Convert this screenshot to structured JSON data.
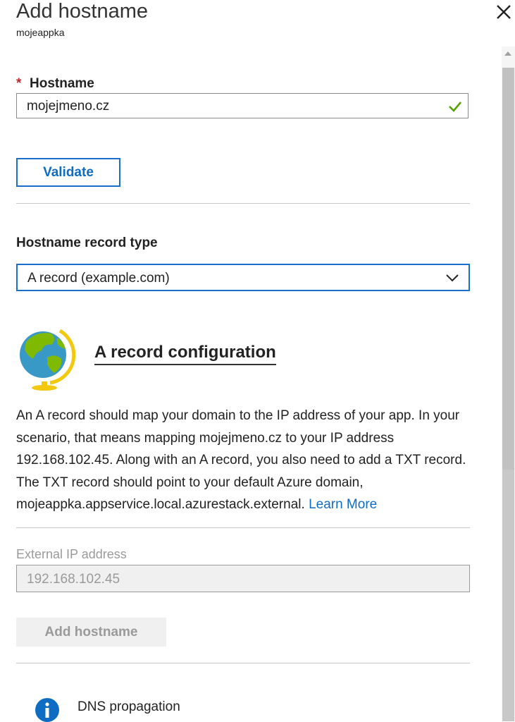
{
  "header": {
    "title": "Add hostname",
    "subtitle": "mojeappka",
    "close_icon": "close-icon"
  },
  "hostname": {
    "required_marker": "*",
    "label": "Hostname",
    "value": "mojejmeno.cz",
    "valid_icon": "checkmark-icon"
  },
  "validate_button": "Validate",
  "record_type": {
    "label": "Hostname record type",
    "selected": "A record (example.com)",
    "chevron_icon": "chevron-down-icon"
  },
  "config": {
    "icon": "globe-icon",
    "title": "A record configuration",
    "description": "An A record should map your domain to the IP address of your app. In your scenario, that means mapping mojejmeno.cz to your IP address 192.168.102.45. Along with an A record, you also need to add a TXT record. The TXT record should point to your default Azure domain, mojeappka.appservice.local.azurestack.external.",
    "learn_more": "Learn More"
  },
  "external_ip": {
    "label": "External IP address",
    "value": "192.168.102.45"
  },
  "add_button": "Add hostname",
  "dns": {
    "icon": "info-icon",
    "label": "DNS propagation"
  },
  "colors": {
    "accent": "#0f6cc3",
    "required": "#c4262e",
    "valid": "#57a300",
    "disabled_text": "#9a9a9a"
  }
}
